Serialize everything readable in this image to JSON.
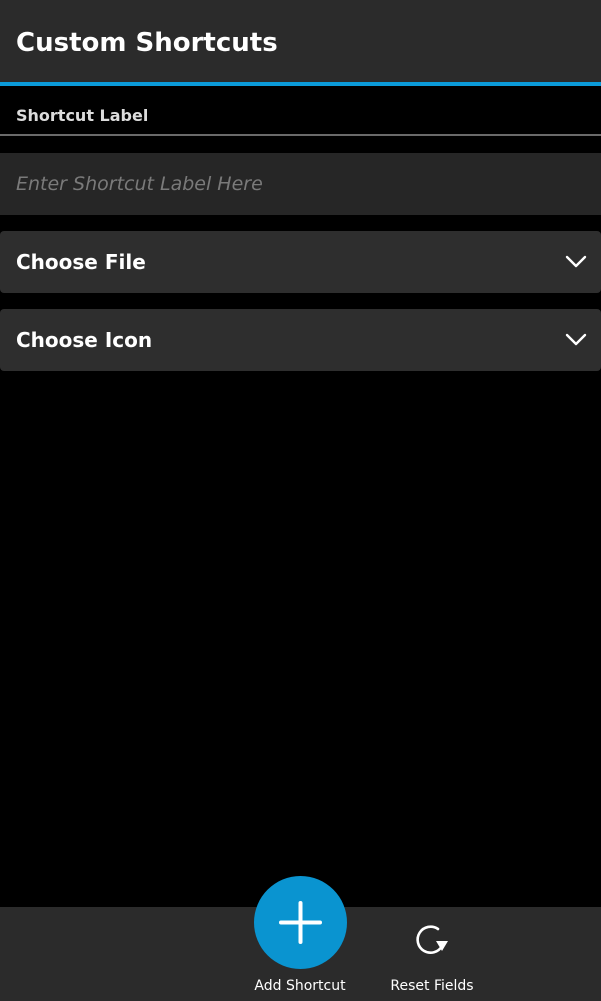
{
  "app": {
    "title": "Custom Shortcuts",
    "accent_color": "#0b9bd9"
  },
  "form": {
    "section_header": "Shortcut Label",
    "label_input": {
      "value": "",
      "placeholder": "Enter Shortcut Label Here"
    },
    "file_dropdown": {
      "label": "Choose File",
      "icon": "chevron-down-icon"
    },
    "icon_dropdown": {
      "label": "Choose Icon",
      "icon": "chevron-down-icon"
    }
  },
  "action_bar": {
    "add_shortcut": {
      "label": "Add Shortcut",
      "icon": "plus-icon",
      "color": "#0a94d0"
    },
    "reset_fields": {
      "label": "Reset Fields",
      "icon": "reset-icon"
    }
  }
}
